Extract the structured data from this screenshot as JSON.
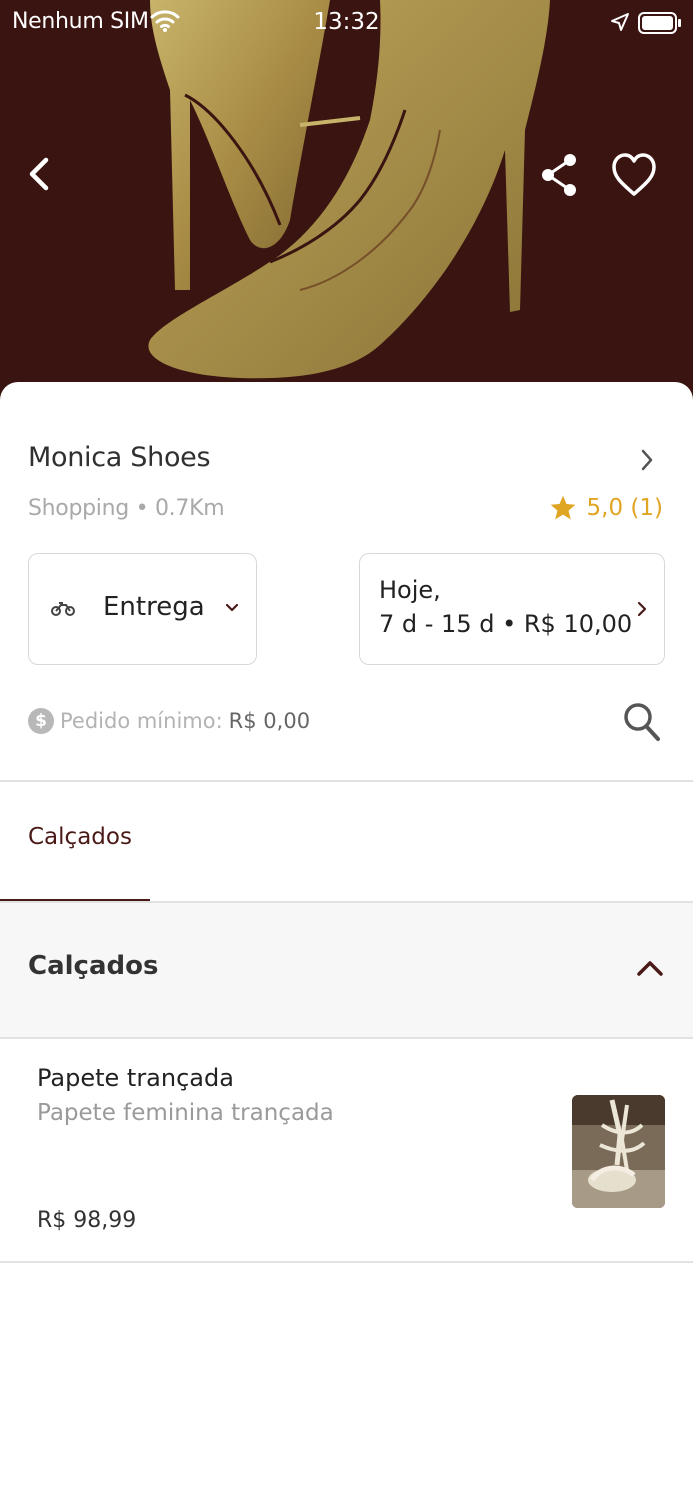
{
  "status_bar": {
    "carrier": "Nenhum SIM",
    "time": "13:32",
    "icons": [
      "wifi-icon",
      "location-arrow-icon",
      "battery-icon"
    ]
  },
  "hero": {
    "background_color": "#3a1410",
    "image_subject": "gold high-heel shoe",
    "icons": [
      "back-chevron-icon",
      "share-icon",
      "heart-icon"
    ]
  },
  "store": {
    "name": "Monica Shoes",
    "meta": "Shopping • 0.7Km",
    "rating": "5,0 (1)",
    "rating_color": "#e0a623"
  },
  "delivery": {
    "mode_label": "Entrega",
    "schedule_line1": "Hoje,",
    "schedule_line2": "7 d - 15 d • R$ 10,00"
  },
  "minimum_order": {
    "icon_text": "$",
    "label": "Pedido mínimo:",
    "value": "R$ 0,00"
  },
  "tabs": [
    {
      "label": "Calçados",
      "active": true
    }
  ],
  "section": {
    "title": "Calçados",
    "expanded": true
  },
  "products": [
    {
      "name": "Papete trançada",
      "description": "Papete feminina trançada",
      "price": "R$ 98,99"
    }
  ],
  "theme": {
    "accent": "#4a1a18",
    "gold": "#b09a55"
  }
}
